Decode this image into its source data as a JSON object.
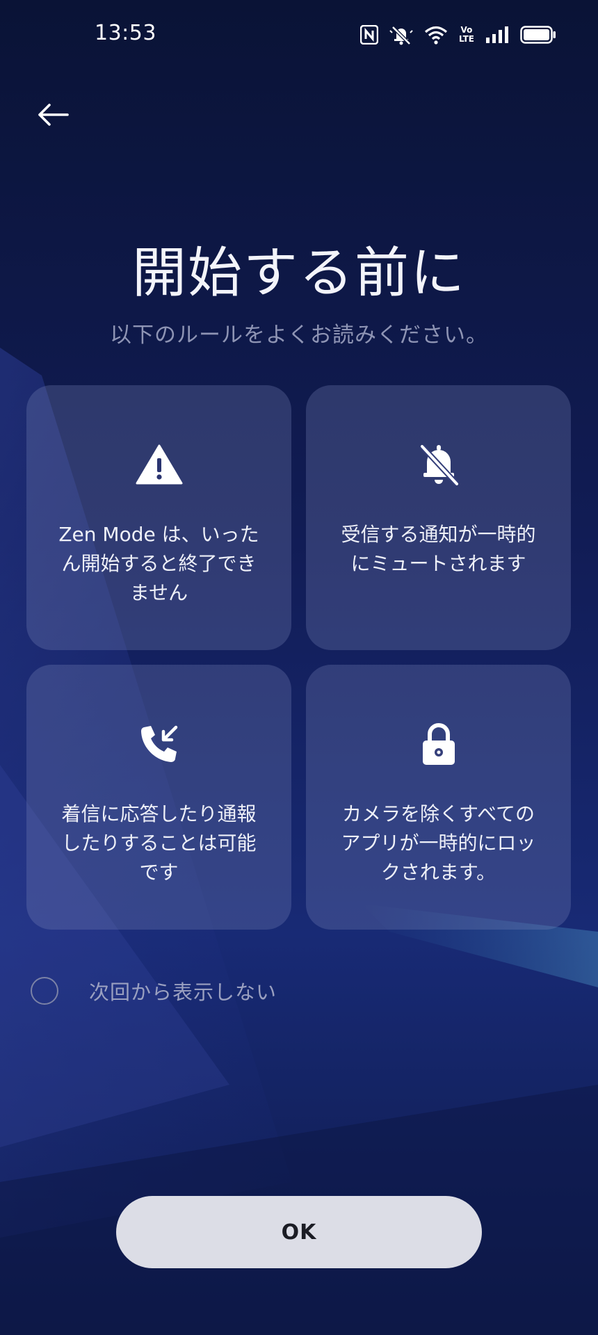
{
  "status_bar": {
    "time": "13:53",
    "icons": [
      "nfc-icon",
      "notifications-muted-icon",
      "wifi-icon",
      "volte-icon",
      "signal-icon",
      "battery-icon"
    ],
    "volte_top": "Vo",
    "volte_bottom": "LTE"
  },
  "header": {
    "back_icon": "arrow-left-icon"
  },
  "main": {
    "title": "開始する前に",
    "subtitle": "以下のルールをよくお読みください。"
  },
  "cards": [
    {
      "icon": "warning-icon",
      "text": "Zen Mode は、いったん開始すると終了できません"
    },
    {
      "icon": "bell-off-icon",
      "text": "受信する通知が一時的にミュートされます"
    },
    {
      "icon": "incoming-call-icon",
      "text": "着信に応答したり通報したりすることは可能です"
    },
    {
      "icon": "lock-icon",
      "text": "カメラを除くすべてのアプリが一時的にロックされます。"
    }
  ],
  "dont_show_again": {
    "label": "次回から表示しない",
    "checked": false
  },
  "ok_button": {
    "label": "OK"
  },
  "colors": {
    "background_top": "#0a1336",
    "background_bottom": "#182a75",
    "card": "#3c4680",
    "button": "#dcdde6",
    "button_text": "#1b1c24"
  }
}
